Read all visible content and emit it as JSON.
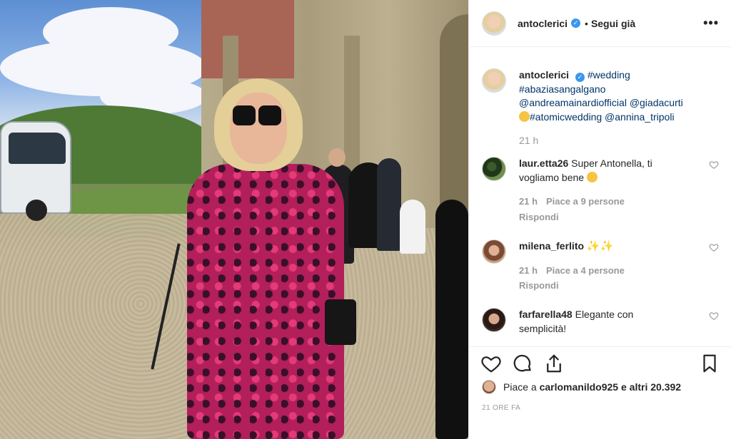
{
  "post": {
    "author": "antoclerici",
    "follow_label": "Segui già",
    "more_label": "•••",
    "caption": {
      "author": "antoclerici",
      "text_line1": "#wedding",
      "text_line2": "#abaziasangalgano",
      "text_line3": "@andreamainardiofficial @giadacurti",
      "text_line4": "#atomicwedding @annina_tripoli",
      "time": "21 h"
    },
    "comments": [
      {
        "user": "laur.etta26",
        "text1": "Super Antonella, ti",
        "text2": "vogliamo bene",
        "time": "21 h",
        "likes": "Piace a 9 persone",
        "reply": "Rispondi"
      },
      {
        "user": "milena_ferlito",
        "text1": "",
        "time": "21 h",
        "likes": "Piace a 4 persone",
        "reply": "Rispondi"
      },
      {
        "user": "farfarella48",
        "text1": "Elegante con",
        "text2": "semplicità!"
      }
    ],
    "likes": {
      "prefix": "Piace a",
      "user": "carlomanildo925",
      "suffix": "e altri 20.392"
    },
    "time_ago": "21 ORE FA"
  },
  "icons": [
    "heart-icon",
    "comment-icon",
    "share-icon",
    "bookmark-icon",
    "verified-icon",
    "more-icon"
  ],
  "colors": {
    "verified": "#3897f0",
    "muted": "#999999",
    "tag": "#003569"
  }
}
